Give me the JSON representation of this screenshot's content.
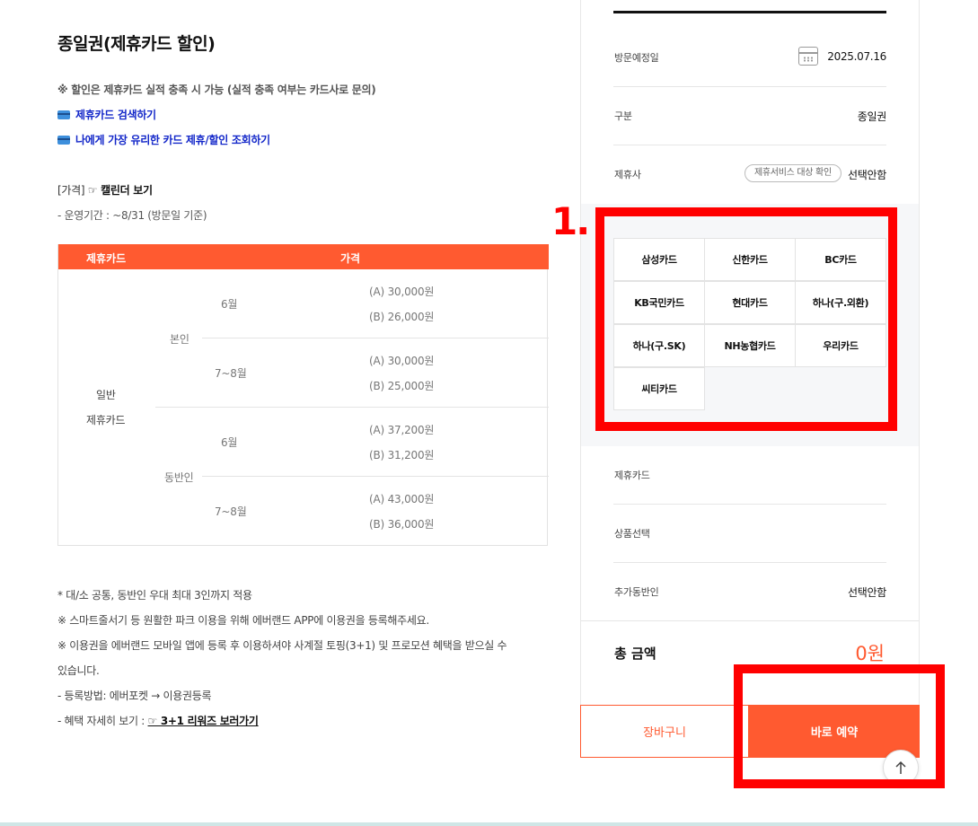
{
  "left": {
    "title": "종일권(제휴카드 할인)",
    "note": "※ 할인은 제휴카드 실적 충족 시 가능 (실적 충족 여부는 카드사로 문의)",
    "link1": "제휴카드 검색하기",
    "link2": "나에게 가장 유리한 카드 제휴/할인 조회하기",
    "price_label_prefix": "[가격]",
    "price_label_link": "☞ 캘린더 보기",
    "period": "- 운영기간 : ~8/31 (방문일 기준)"
  },
  "table": {
    "headers": [
      "제휴카드",
      "가격"
    ],
    "group_line1": "일반",
    "group_line2": "제휴카드",
    "type_self": "본인",
    "type_companion": "동반인",
    "rows": [
      {
        "month": "6월",
        "a": "(A) 30,000원",
        "b": "(B) 26,000원"
      },
      {
        "month": "7~8월",
        "a": "(A) 30,000원",
        "b": "(B) 25,000원"
      },
      {
        "month": "6월",
        "a": "(A) 37,200원",
        "b": "(B) 31,200원"
      },
      {
        "month": "7~8월",
        "a": "(A) 43,000원",
        "b": "(B) 36,000원"
      }
    ]
  },
  "footnotes": {
    "f1": "* 대/소 공통, 동반인 우대 최대 3인까지 적용",
    "f2": "※ 스마트줄서기 등 원활한 파크 이용을 위해 에버랜드 APP에 이용권을 등록해주세요.",
    "f3a": "※ 이용권을 에버랜드 모바일 앱에 등록 후 이용하셔야 사계절 토핑(3+1) 및 프로모션 혜택을 받으실 수",
    "f3b": "있습니다.",
    "f4": "- 등록방법: 에버포켓 → 이용권등록",
    "f5_prefix": "- 혜택 자세히 보기 :",
    "f5_link": "☞ 3+1 리워즈 보러가기"
  },
  "panel": {
    "visit_label": "방문예정일",
    "visit_value": "2025.07.16",
    "type_label": "구분",
    "type_value": "종일권",
    "partner_label": "제휴사",
    "partner_chip": "제휴서비스 대상 확인",
    "partner_value": "선택안함",
    "cards": [
      "삼성카드",
      "신한카드",
      "BC카드",
      "KB국민카드",
      "현대카드",
      "하나(구.외환)",
      "하나(구.SK)",
      "NH농협카드",
      "우리카드",
      "씨티카드"
    ],
    "card_label": "제휴카드",
    "product_label": "상품선택",
    "companion_label": "추가동반인",
    "companion_value": "선택안함",
    "total_label": "총 금액",
    "total_value": "0원",
    "cart_button": "장바구니",
    "book_button": "바로 예약"
  },
  "annotation": {
    "number": "1.",
    "color": "#ff0000"
  },
  "colors": {
    "accent": "#ff5a30",
    "link": "#1327c9"
  }
}
